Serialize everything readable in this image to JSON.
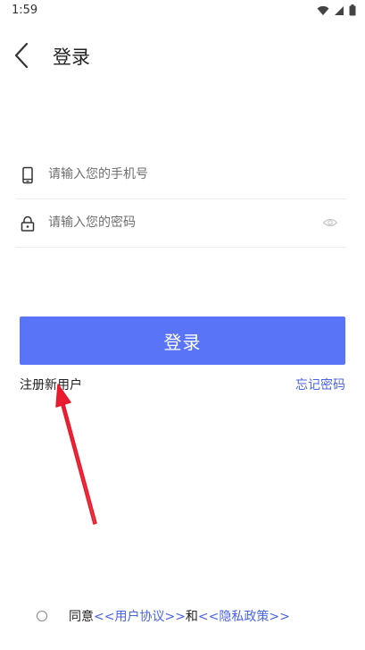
{
  "status_bar": {
    "time": "1:59"
  },
  "header": {
    "title": "登录"
  },
  "form": {
    "phone_placeholder": "请输入您的手机号",
    "password_placeholder": "请输入您的密码"
  },
  "actions": {
    "login_label": "登录",
    "register_label": "注册新用户",
    "forgot_label": "忘记密码"
  },
  "agreement": {
    "prefix": "同意",
    "user_agreement": "<<用户协议>>",
    "conjunction": "和",
    "privacy_policy": "<<隐私政策>>",
    "checked": false
  },
  "colors": {
    "accent": "#5a74f7",
    "link": "#4a64e8",
    "annotation_arrow": "#e8192c"
  },
  "icons": [
    "wifi-icon",
    "signal-icon",
    "battery-icon",
    "back-arrow-icon",
    "phone-icon",
    "lock-icon",
    "eye-icon"
  ]
}
